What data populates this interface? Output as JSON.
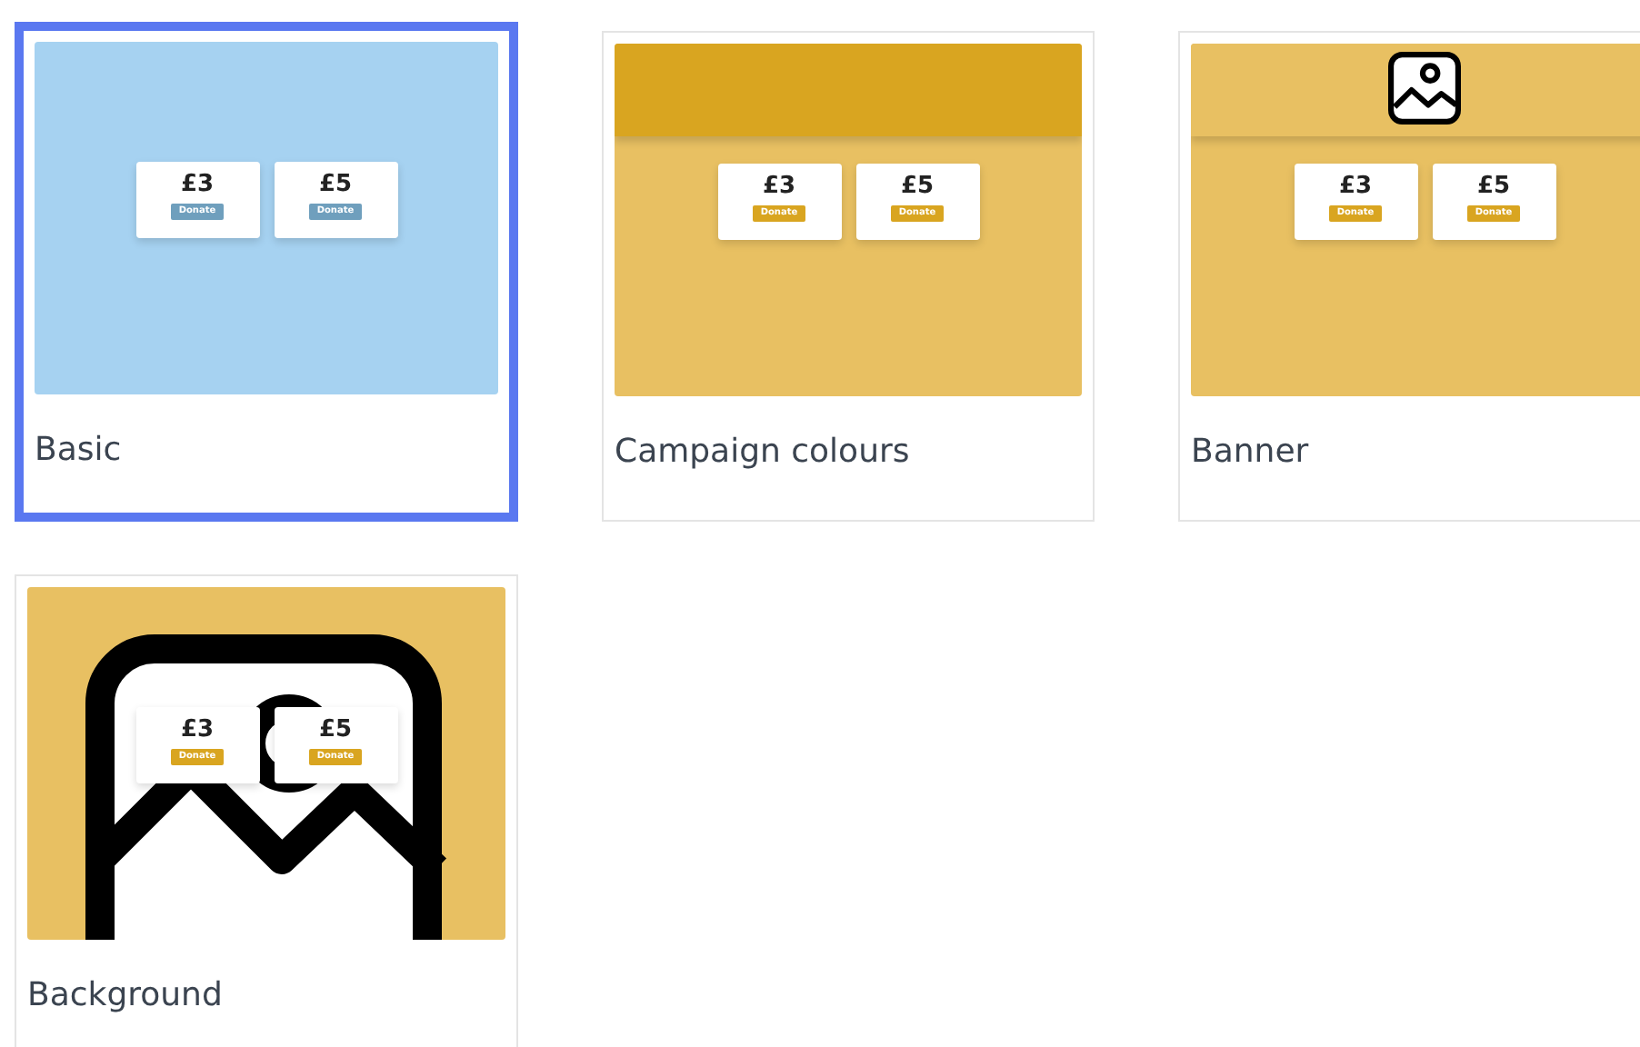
{
  "templates": [
    {
      "label": "Basic",
      "selected": true,
      "kind": "basic",
      "amounts": [
        {
          "amount": "£3",
          "button": "Donate"
        },
        {
          "amount": "£5",
          "button": "Donate"
        }
      ]
    },
    {
      "label": "Campaign colours",
      "selected": false,
      "kind": "campaign",
      "amounts": [
        {
          "amount": "£3",
          "button": "Donate"
        },
        {
          "amount": "£5",
          "button": "Donate"
        }
      ]
    },
    {
      "label": "Banner",
      "selected": false,
      "kind": "banner",
      "amounts": [
        {
          "amount": "£3",
          "button": "Donate"
        },
        {
          "amount": "£5",
          "button": "Donate"
        }
      ]
    },
    {
      "label": "Background",
      "selected": false,
      "kind": "background",
      "amounts": [
        {
          "amount": "£3",
          "button": "Donate"
        },
        {
          "amount": "£5",
          "button": "Donate"
        }
      ]
    }
  ]
}
